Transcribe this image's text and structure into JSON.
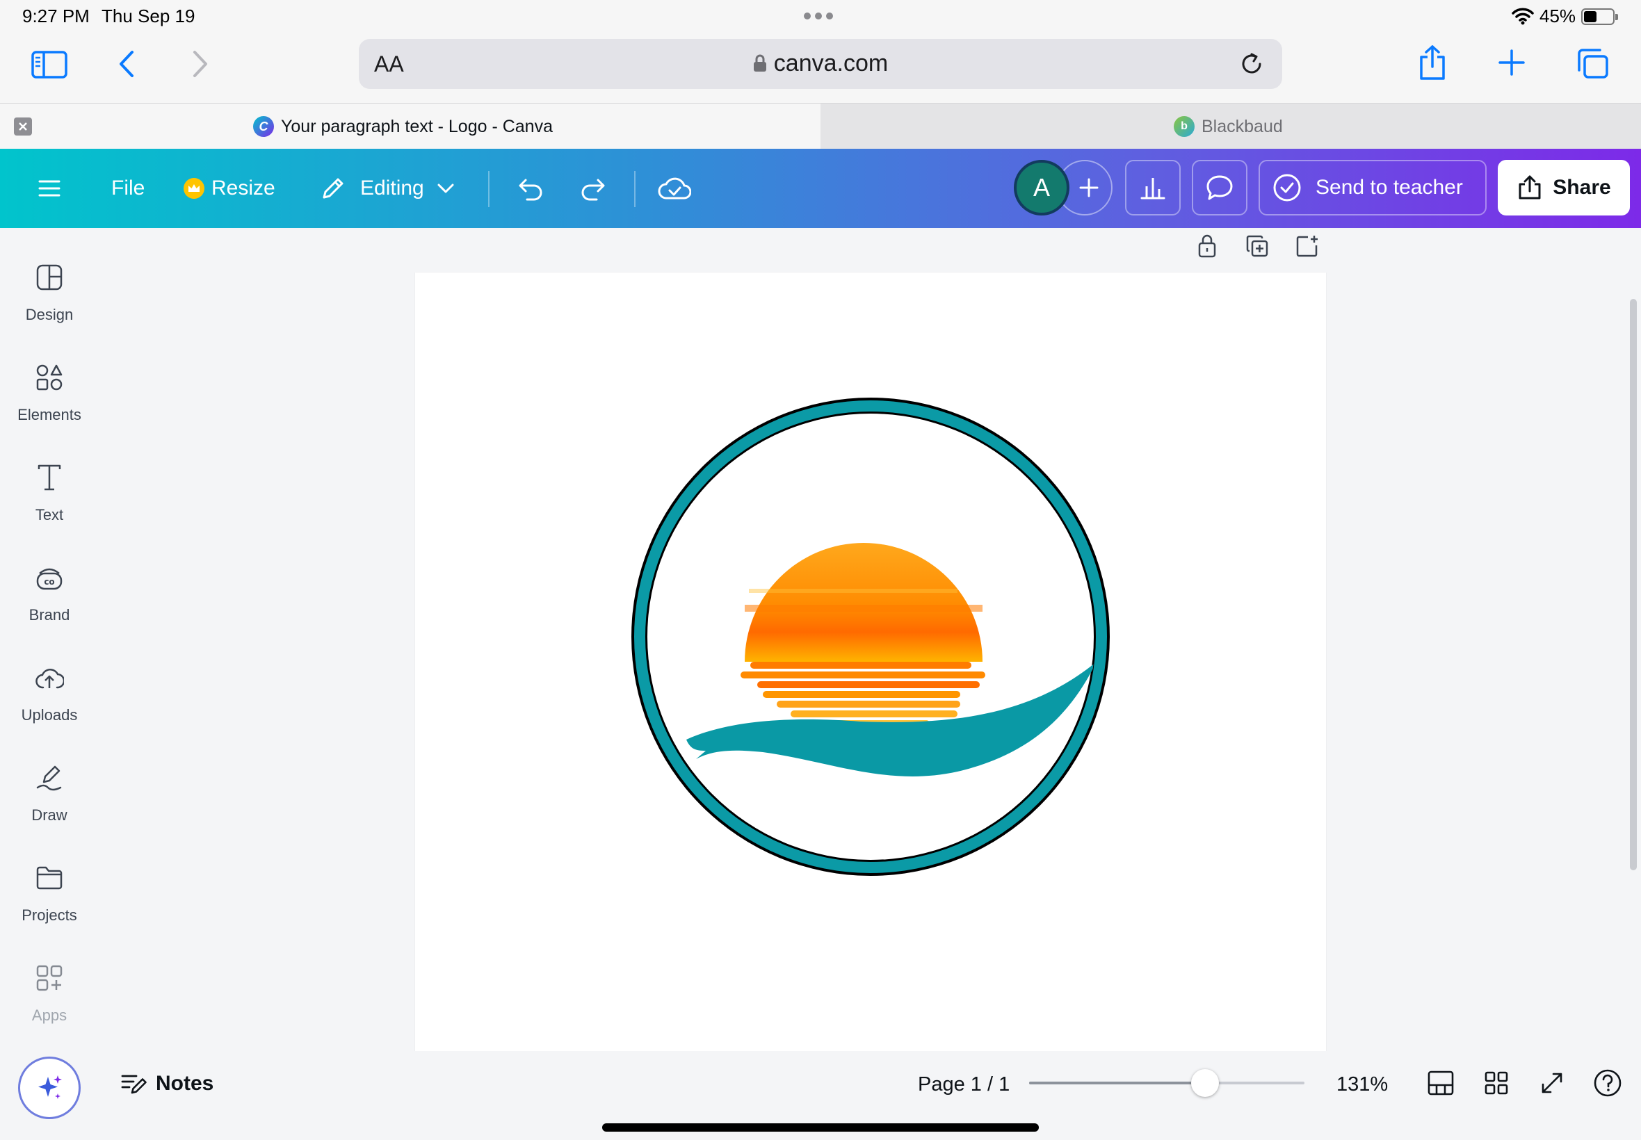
{
  "status_bar": {
    "time": "9:27 PM",
    "date": "Thu Sep 19",
    "battery": "45%",
    "battery_level": 0.45
  },
  "safari": {
    "text_size_label": "AA",
    "url": "canva.com",
    "tabs": [
      {
        "title": "Your paragraph text - Logo - Canva",
        "active": true
      },
      {
        "title": "Blackbaud",
        "active": false
      }
    ]
  },
  "canva_header": {
    "file_label": "File",
    "resize_label": "Resize",
    "mode_label": "Editing",
    "avatar_initial": "A",
    "send_label": "Send to teacher",
    "share_label": "Share",
    "colors": {
      "gradient_start": "#01c4cc",
      "gradient_end": "#7d2ae8",
      "avatar": "#137a6d"
    }
  },
  "sidebar": {
    "items": [
      {
        "label": "Design",
        "icon": "design-icon"
      },
      {
        "label": "Elements",
        "icon": "elements-icon"
      },
      {
        "label": "Text",
        "icon": "text-icon"
      },
      {
        "label": "Brand",
        "icon": "brand-icon"
      },
      {
        "label": "Uploads",
        "icon": "uploads-icon"
      },
      {
        "label": "Draw",
        "icon": "draw-icon"
      },
      {
        "label": "Projects",
        "icon": "projects-icon"
      },
      {
        "label": "Apps",
        "icon": "apps-icon"
      }
    ]
  },
  "canvas": {
    "logo_colors": {
      "ring": "#0b9aa6",
      "ring_outline": "#000000",
      "sun_top": "#ffb21c",
      "sun_bottom": "#ff6a00",
      "wave": "#0a99a5"
    }
  },
  "bottom_bar": {
    "notes_label": "Notes",
    "page_label": "Page 1 / 1",
    "zoom": "131%",
    "zoom_slider_level": 0.64
  }
}
